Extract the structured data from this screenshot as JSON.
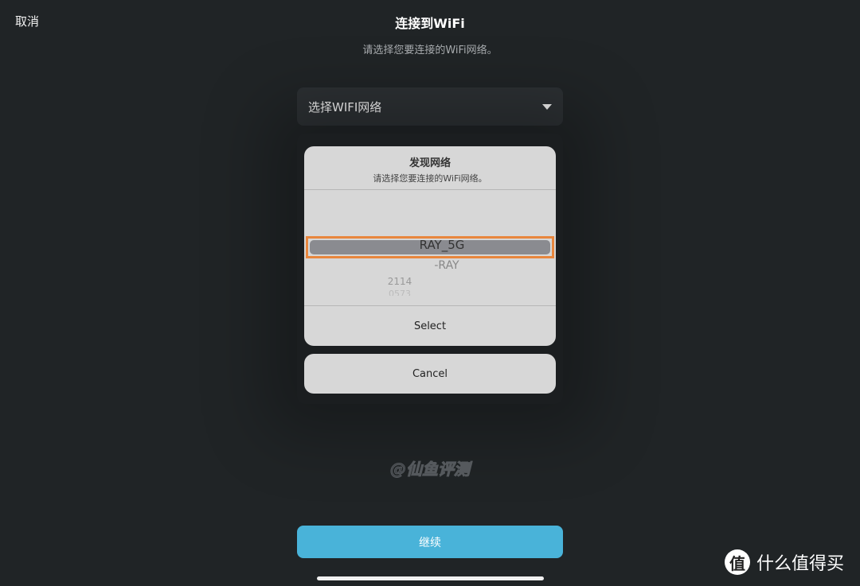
{
  "header": {
    "cancel": "取消",
    "title": "连接到WiFi",
    "subtitle": "请选择您要连接的WiFi网络。"
  },
  "wifi_select": {
    "placeholder": "选择WIFI网络",
    "icon": "triangle-down-icon"
  },
  "picker_sheet": {
    "title": "发现网络",
    "subtitle": "请选择您要连接的WiFi网络。",
    "options": [
      "RAY_5G",
      "-RAY",
      "2114",
      "0573"
    ],
    "selected": "RAY_5G",
    "highlight_color": "#e8863d",
    "select_label": "Select",
    "cancel_label": "Cancel"
  },
  "watermark": "@仙鱼评测",
  "continue_label": "继续",
  "accent_color": "#49b3d9",
  "corner_logo": {
    "badge": "值",
    "text": "什么值得买"
  }
}
